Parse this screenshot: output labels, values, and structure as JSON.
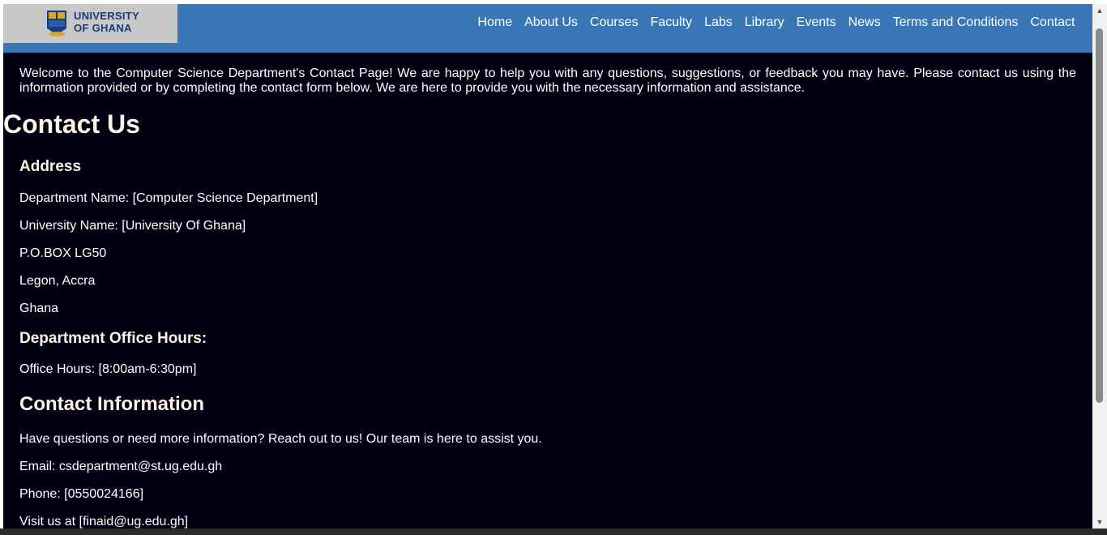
{
  "logo": {
    "line1": "UNIVERSITY",
    "line2": "OF GHANA"
  },
  "nav": {
    "items": [
      {
        "label": "Home"
      },
      {
        "label": "About Us"
      },
      {
        "label": "Courses"
      },
      {
        "label": "Faculty"
      },
      {
        "label": "Labs"
      },
      {
        "label": "Library"
      },
      {
        "label": "Events"
      },
      {
        "label": "News"
      },
      {
        "label": "Terms and Conditions"
      },
      {
        "label": "Contact"
      }
    ]
  },
  "intro": "Welcome to the Computer Science Department's Contact Page! We are happy to help you with any questions, suggestions, or feedback you may have. Please contact us using the information provided or by completing the contact form below. We are here to provide you with the necessary information and assistance.",
  "page_title": "Contact Us",
  "address": {
    "heading": "Address",
    "lines": [
      "Department Name: [Computer Science Department]",
      "University Name: [University Of Ghana]",
      "P.O.BOX LG50",
      "Legon, Accra",
      "Ghana"
    ]
  },
  "office_hours": {
    "heading": "Department Office Hours:",
    "text": "Office Hours: [8:00am-6:30pm]"
  },
  "contact_info": {
    "heading": "Contact Information",
    "lines": [
      "Have questions or need more information? Reach out to us! Our team is here to assist you.",
      "Email: csdepartment@st.ug.edu.gh",
      "Phone: [0550024166]",
      "Visit us at [finaid@ug.edu.gh]"
    ]
  },
  "colors": {
    "nav_bg": "#3976b6",
    "page_bg": "#000010",
    "logo_text": "#1b3a7a",
    "heading_text": "#fdf3e6"
  }
}
